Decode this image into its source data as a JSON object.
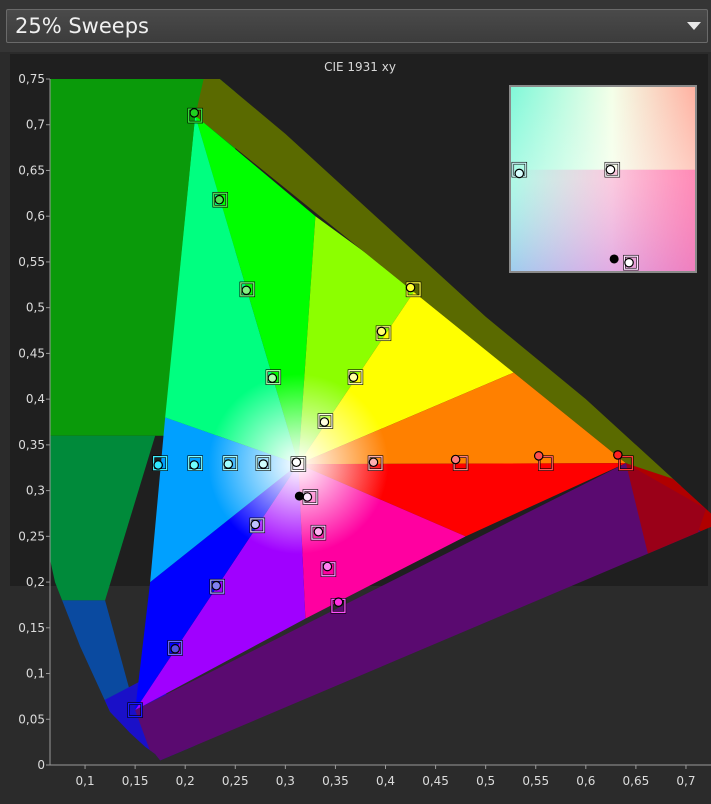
{
  "header": {
    "preset_select_value": "25% Sweeps"
  },
  "chart_data": {
    "type": "scatter",
    "title": "CIE 1931 xy",
    "xlabel": "",
    "ylabel": "",
    "xlim": [
      0.065,
      0.725
    ],
    "ylim": [
      0,
      0.75
    ],
    "x_ticks": [
      "0,1",
      "0,15",
      "0,2",
      "0,25",
      "0,3",
      "0,35",
      "0,4",
      "0,45",
      "0,5",
      "0,55",
      "0,6",
      "0,65",
      "0,7"
    ],
    "y_ticks": [
      "0",
      "0,05",
      "0,1",
      "0,15",
      "0,2",
      "0,25",
      "0,3",
      "0,35",
      "0,4",
      "0,45",
      "0,5",
      "0,55",
      "0,6",
      "0,65",
      "0,7",
      "0,75"
    ],
    "grid": false,
    "gamut_triangle": {
      "red": [
        0.64,
        0.33
      ],
      "green": [
        0.21,
        0.71
      ],
      "blue": [
        0.15,
        0.06
      ]
    },
    "series": [
      {
        "marker": "square",
        "points": [
          {
            "x": 0.64,
            "y": 0.33,
            "color": "#ff3a3a"
          },
          {
            "x": 0.56,
            "y": 0.33,
            "color": "#ff5a5a"
          },
          {
            "x": 0.475,
            "y": 0.33,
            "color": "#ff8080"
          },
          {
            "x": 0.39,
            "y": 0.33,
            "color": "#ffb0b0"
          },
          {
            "x": 0.313,
            "y": 0.329,
            "color": "#ffffff"
          },
          {
            "x": 0.278,
            "y": 0.33,
            "color": "#c8ffff"
          },
          {
            "x": 0.245,
            "y": 0.33,
            "color": "#a8ffff"
          },
          {
            "x": 0.21,
            "y": 0.33,
            "color": "#80ffff"
          },
          {
            "x": 0.175,
            "y": 0.33,
            "color": "#40f0ff"
          },
          {
            "x": 0.21,
            "y": 0.71,
            "color": "#3ae83a"
          },
          {
            "x": 0.235,
            "y": 0.618,
            "color": "#5ae85a"
          },
          {
            "x": 0.262,
            "y": 0.52,
            "color": "#80f080"
          },
          {
            "x": 0.288,
            "y": 0.424,
            "color": "#b0ffb0"
          },
          {
            "x": 0.428,
            "y": 0.52,
            "color": "#ffff40"
          },
          {
            "x": 0.398,
            "y": 0.472,
            "color": "#ffff80"
          },
          {
            "x": 0.37,
            "y": 0.424,
            "color": "#ffffb0"
          },
          {
            "x": 0.34,
            "y": 0.376,
            "color": "#ffffe0"
          },
          {
            "x": 0.15,
            "y": 0.06,
            "color": "#1a1aff"
          },
          {
            "x": 0.19,
            "y": 0.128,
            "color": "#6a6aff"
          },
          {
            "x": 0.232,
            "y": 0.195,
            "color": "#9a9aff"
          },
          {
            "x": 0.272,
            "y": 0.262,
            "color": "#c8c8ff"
          },
          {
            "x": 0.325,
            "y": 0.293,
            "color": "#ffe0ff"
          },
          {
            "x": 0.333,
            "y": 0.254,
            "color": "#ffc0ff"
          },
          {
            "x": 0.343,
            "y": 0.214,
            "color": "#ff90ff"
          },
          {
            "x": 0.353,
            "y": 0.174,
            "color": "#ff50ff"
          }
        ]
      },
      {
        "marker": "circle",
        "points": [
          {
            "x": 0.632,
            "y": 0.339,
            "color": "#ff2020"
          },
          {
            "x": 0.553,
            "y": 0.338,
            "color": "#ff5050"
          },
          {
            "x": 0.47,
            "y": 0.334,
            "color": "#ff7a7a"
          },
          {
            "x": 0.388,
            "y": 0.331,
            "color": "#ffb0b0"
          },
          {
            "x": 0.311,
            "y": 0.331,
            "color": "#ffffff"
          },
          {
            "x": 0.278,
            "y": 0.329,
            "color": "#d0ffff"
          },
          {
            "x": 0.243,
            "y": 0.329,
            "color": "#a0ffff"
          },
          {
            "x": 0.209,
            "y": 0.328,
            "color": "#70ffff"
          },
          {
            "x": 0.173,
            "y": 0.328,
            "color": "#30e8ff"
          },
          {
            "x": 0.209,
            "y": 0.713,
            "color": "#20d020"
          },
          {
            "x": 0.234,
            "y": 0.618,
            "color": "#50e050"
          },
          {
            "x": 0.261,
            "y": 0.519,
            "color": "#80f080"
          },
          {
            "x": 0.287,
            "y": 0.423,
            "color": "#b0ffb0"
          },
          {
            "x": 0.425,
            "y": 0.522,
            "color": "#ffff30"
          },
          {
            "x": 0.396,
            "y": 0.474,
            "color": "#ffff70"
          },
          {
            "x": 0.368,
            "y": 0.424,
            "color": "#ffffa0"
          },
          {
            "x": 0.339,
            "y": 0.375,
            "color": "#ffffe0"
          },
          {
            "x": 0.19,
            "y": 0.127,
            "color": "#5050e0"
          },
          {
            "x": 0.231,
            "y": 0.196,
            "color": "#8080f0"
          },
          {
            "x": 0.27,
            "y": 0.263,
            "color": "#c0c0ff"
          },
          {
            "x": 0.322,
            "y": 0.293,
            "color": "#ffe8ff"
          },
          {
            "x": 0.333,
            "y": 0.255,
            "color": "#ffb0f0"
          },
          {
            "x": 0.342,
            "y": 0.217,
            "color": "#ff80f0"
          },
          {
            "x": 0.353,
            "y": 0.178,
            "color": "#ff30e0"
          }
        ]
      },
      {
        "marker": "dot",
        "points": [
          {
            "x": 0.314,
            "y": 0.294,
            "color": "#000000"
          }
        ]
      }
    ],
    "inset": {
      "squares": [
        {
          "x": 0.05,
          "y": 0.55,
          "color": "#d0ffff"
        },
        {
          "x": 0.55,
          "y": 0.55,
          "color": "#ffffff"
        },
        {
          "x": 0.65,
          "y": 0.05,
          "color": "#ffe0ff"
        }
      ],
      "circles": [
        {
          "x": 0.05,
          "y": 0.53,
          "color": "#d8ffff"
        },
        {
          "x": 0.54,
          "y": 0.55,
          "color": "#ffffff"
        },
        {
          "x": 0.64,
          "y": 0.05,
          "color": "#ffffff"
        }
      ],
      "dots": [
        {
          "x": 0.56,
          "y": 0.07,
          "color": "#000000"
        }
      ]
    }
  }
}
